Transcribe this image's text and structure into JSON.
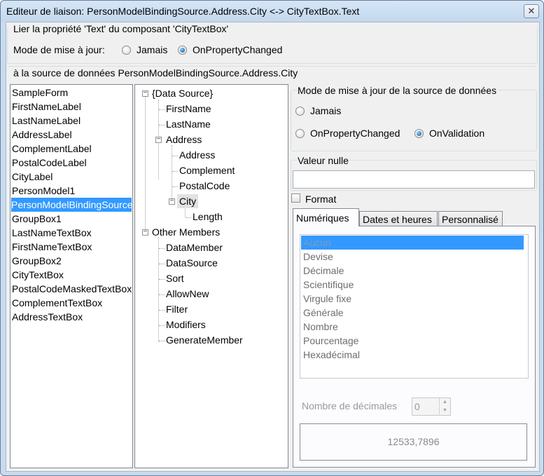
{
  "window": {
    "title": "Editeur de liaison: PersonModelBindingSource.Address.City <-> CityTextBox.Text",
    "close_glyph": "✕"
  },
  "binding_group": {
    "caption": "Lier la propriété 'Text' du composant 'CityTextBox'",
    "update_mode_label": "Mode de mise à jour:",
    "options": [
      "Jamais",
      "OnPropertyChanged"
    ],
    "selected": "OnPropertyChanged"
  },
  "source_caption": "à la source de données PersonModelBindingSource.Address.City",
  "components": [
    "SampleForm",
    "FirstNameLabel",
    "LastNameLabel",
    "AddressLabel",
    "ComplementLabel",
    "PostalCodeLabel",
    "CityLabel",
    "PersonModel1",
    "PersonModelBindingSource",
    "GroupBox1",
    "LastNameTextBox",
    "FirstNameTextBox",
    "GroupBox2",
    "CityTextBox",
    "PostalCodeMaskedTextBox",
    "ComplementTextBox",
    "AddressTextBox"
  ],
  "selected_component": "PersonModelBindingSource",
  "tree": {
    "data_source": "{Data Source}",
    "first_name": "FirstName",
    "last_name": "LastName",
    "address": "Address",
    "address_child": "Address",
    "complement": "Complement",
    "postal_code": "PostalCode",
    "city": "City",
    "length": "Length",
    "other_members": "Other Members",
    "data_member": "DataMember",
    "data_source_member": "DataSource",
    "sort": "Sort",
    "allow_new": "AllowNew",
    "filter": "Filter",
    "modifiers": "Modifiers",
    "generate_member": "GenerateMember",
    "expander_glyph": "−"
  },
  "source_update": {
    "caption": "Mode de mise à jour de la source de données",
    "options": [
      "Jamais",
      "OnPropertyChanged",
      "OnValidation"
    ],
    "selected": "OnValidation"
  },
  "null_value": {
    "caption": "Valeur nulle",
    "value": ""
  },
  "format": {
    "label": "Format",
    "checked": false,
    "tabs": [
      "Numériques",
      "Dates et heures",
      "Personnalisé"
    ],
    "active_tab": "Numériques",
    "items": [
      "Aucun",
      "Devise",
      "Décimale",
      "Scientifique",
      "Virgule fixe",
      "Générale",
      "Nombre",
      "Pourcentage",
      "Hexadécimal"
    ],
    "selected_item": "Aucun",
    "decimals_label": "Nombre de décimales",
    "decimals_value": "0",
    "preview": "12533,7896"
  }
}
